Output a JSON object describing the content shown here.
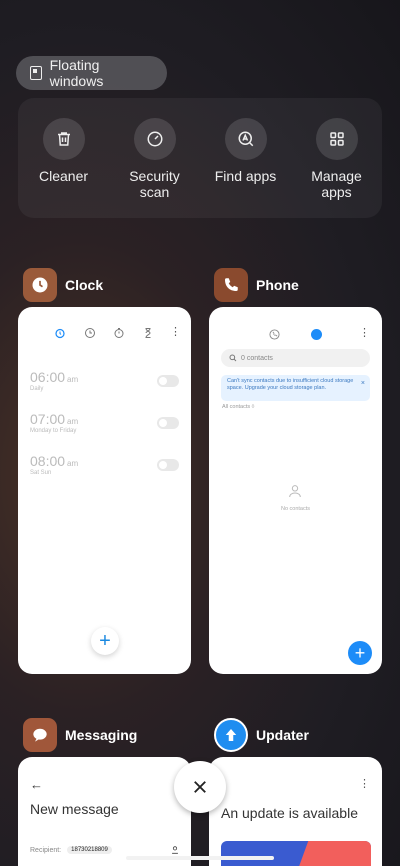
{
  "floating_windows": {
    "label": "Floating windows"
  },
  "tools": [
    {
      "label": "Cleaner",
      "icon": "trash-icon"
    },
    {
      "label": "Security scan",
      "icon": "speedometer-icon"
    },
    {
      "label": "Find apps",
      "icon": "find-apps-icon"
    },
    {
      "label": "Manage apps",
      "icon": "grid-icon"
    }
  ],
  "apps": {
    "clock": {
      "name": "Clock",
      "alarms": [
        {
          "time": "06:00",
          "ampm": "am",
          "repeat": "Daily"
        },
        {
          "time": "07:00",
          "ampm": "am",
          "repeat": "Monday to Friday"
        },
        {
          "time": "08:00",
          "ampm": "am",
          "repeat": "Sat Sun"
        }
      ]
    },
    "phone": {
      "name": "Phone",
      "search_placeholder": "0 contacts",
      "sync_notice": "Can't sync contacts due to insufficient cloud storage space. Upgrade your cloud storage plan.",
      "filter_label": "All contacts",
      "no_contacts": "No contacts"
    },
    "messaging": {
      "name": "Messaging",
      "title": "New message",
      "recipient_label": "Recipient:",
      "recipient_value": "18730218809"
    },
    "updater": {
      "name": "Updater",
      "title": "An update is available"
    }
  },
  "colors": {
    "accent_blue": "#1d8cf8",
    "clock_icon": "#9a5a3a",
    "phone_icon": "#8a4a2e",
    "messaging_icon": "#a0573a",
    "updater_icon": "#1f8df0"
  }
}
